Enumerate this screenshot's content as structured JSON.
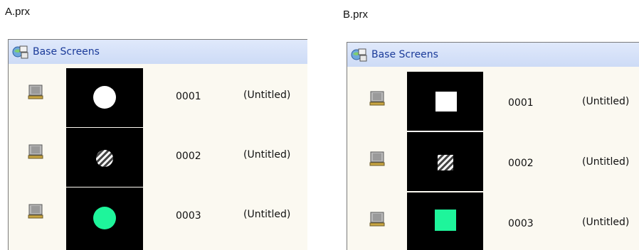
{
  "panes": [
    {
      "file_label": "A.prx",
      "header_title": "Base Screens",
      "rows": [
        {
          "number": "0001",
          "title": "(Untitled)",
          "preview": "white-circle"
        },
        {
          "number": "0002",
          "title": "(Untitled)",
          "preview": "striped-circle"
        },
        {
          "number": "0003",
          "title": "(Untitled)",
          "preview": "green-circle"
        }
      ]
    },
    {
      "file_label": "B.prx",
      "header_title": "Base Screens",
      "rows": [
        {
          "number": "0001",
          "title": "(Untitled)",
          "preview": "white-square"
        },
        {
          "number": "0002",
          "title": "(Untitled)",
          "preview": "striped-square"
        },
        {
          "number": "0003",
          "title": "(Untitled)",
          "preview": "green-square"
        }
      ]
    }
  ],
  "colors": {
    "header_bg": "#cddbf6",
    "header_text": "#1a3a99",
    "pane_bg": "#fbf9f1",
    "thumb_bg": "#000000",
    "accent_green": "#1ef59b"
  },
  "icons": {
    "header": "base-screens-icon",
    "row": "computer-icon"
  }
}
